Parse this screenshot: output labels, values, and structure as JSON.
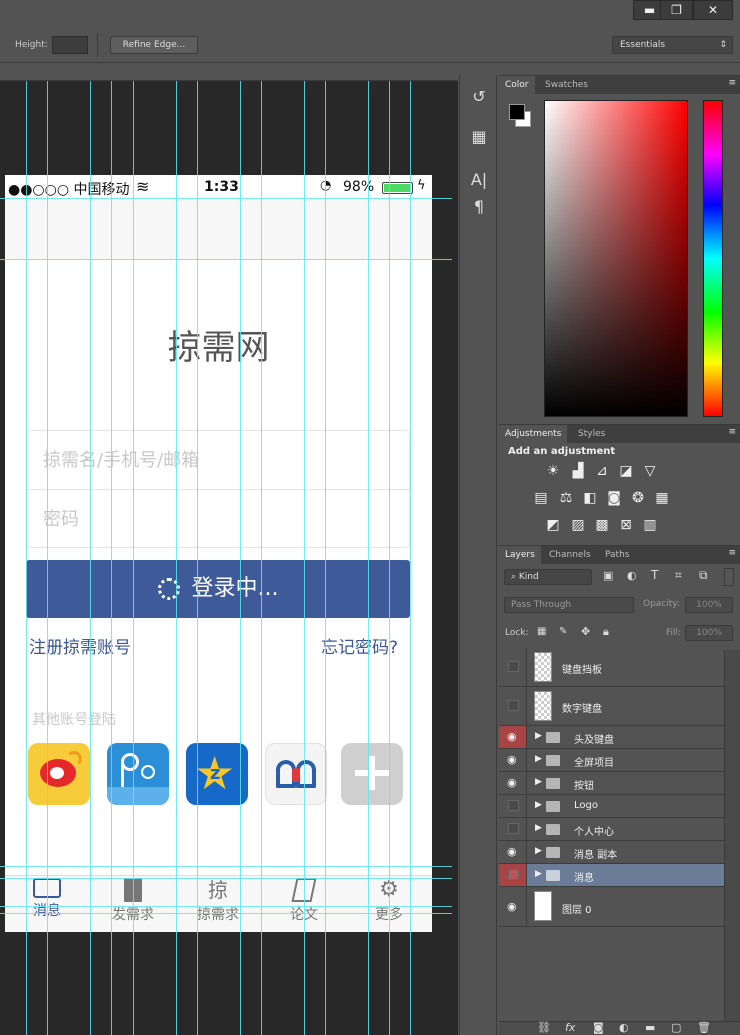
{
  "window": {
    "minimize": "▬",
    "restore": "❐",
    "close": "✕"
  },
  "options": {
    "height_label": "Height:",
    "refine_edge": "Refine Edge...",
    "workspace": "Essentials"
  },
  "canvas": {
    "status": {
      "carrier": "●●○○○ 中国移动",
      "wifi": "≋",
      "time": "1:33",
      "battery": "98%"
    },
    "title": "掠需网",
    "username_placeholder": "掠需名/手机号/邮箱",
    "password_placeholder": "密码",
    "login_label": "登录中...",
    "register_link": "注册掠需账号",
    "forgot_link": "忘记密码?",
    "other_login": "其他账号登陆",
    "socials": [
      {
        "name": "weibo-icon"
      },
      {
        "name": "renren-icon"
      },
      {
        "name": "qzone-icon"
      },
      {
        "name": "other-app-icon"
      },
      {
        "name": "more-icon"
      }
    ],
    "tabs": [
      {
        "label": "消息",
        "icon": "chat-icon"
      },
      {
        "label": "发需求",
        "icon": "document-icon"
      },
      {
        "label": "掠需求",
        "icon": "lue-icon"
      },
      {
        "label": "论文",
        "icon": "paper-icon"
      },
      {
        "label": "更多",
        "icon": "gear-icon"
      }
    ]
  },
  "panels": {
    "color_tabs": [
      "Color",
      "Swatches"
    ],
    "adjustment_tabs": [
      "Adjustments",
      "Styles"
    ],
    "add_adjustment": "Add an adjustment",
    "layers_tabs": [
      "Layers",
      "Channels",
      "Paths"
    ],
    "kind": "Kind",
    "blend_mode": "Pass Through",
    "opacity_label": "Opacity:",
    "opacity_value": "100%",
    "lock_label": "Lock:",
    "fill_label": "Fill:",
    "fill_value": "100%"
  },
  "layers": [
    {
      "name": "键盘挡板",
      "visible": false,
      "type": "image"
    },
    {
      "name": "数字键盘",
      "visible": false,
      "type": "image"
    },
    {
      "name": "头及键盘",
      "visible": true,
      "type": "group",
      "selected_eye": true
    },
    {
      "name": "全屏项目",
      "visible": true,
      "type": "group"
    },
    {
      "name": "按钮",
      "visible": true,
      "type": "group"
    },
    {
      "name": "Logo",
      "visible": false,
      "type": "group"
    },
    {
      "name": "个人中心",
      "visible": false,
      "type": "group"
    },
    {
      "name": "消息 副本",
      "visible": true,
      "type": "group"
    },
    {
      "name": "消息",
      "visible": false,
      "type": "group",
      "active": true
    },
    {
      "name": "图层 0",
      "visible": true,
      "type": "background"
    }
  ],
  "colors": {
    "accent": "#3e5a98",
    "guide": "#5ee6ee",
    "selected_layer": "#6b7d96"
  }
}
